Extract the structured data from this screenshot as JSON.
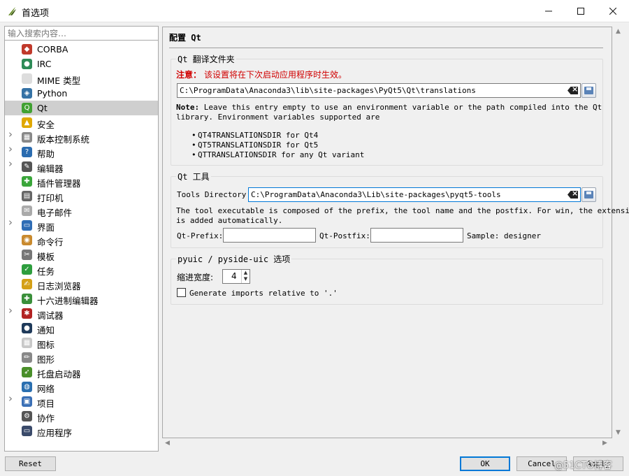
{
  "window": {
    "title": "首选项"
  },
  "sidebar": {
    "search_placeholder": "输入搜索内容…",
    "items": [
      {
        "label": "CORBA",
        "icon": "corba-icon",
        "color": "#c0392b",
        "glyph": "◆",
        "expandable": false
      },
      {
        "label": "IRC",
        "icon": "irc-icon",
        "color": "#2e8b57",
        "glyph": "●",
        "expandable": false
      },
      {
        "label": "MIME 类型",
        "icon": "mime-icon",
        "color": "#dddddd",
        "glyph": "",
        "expandable": false
      },
      {
        "label": "Python",
        "icon": "python-icon",
        "color": "#3572a5",
        "glyph": "◈",
        "expandable": false
      },
      {
        "label": "Qt",
        "icon": "qt-icon",
        "color": "#41a132",
        "glyph": "Q",
        "expandable": false,
        "selected": true
      },
      {
        "label": "安全",
        "icon": "lock-icon",
        "color": "#e0a800",
        "glyph": "▲",
        "expandable": false
      },
      {
        "label": "版本控制系统",
        "icon": "vcs-icon",
        "color": "#888888",
        "glyph": "▦",
        "expandable": true
      },
      {
        "label": "帮助",
        "icon": "help-icon",
        "color": "#2b6cb0",
        "glyph": "?",
        "expandable": true
      },
      {
        "label": "编辑器",
        "icon": "editor-icon",
        "color": "#555555",
        "glyph": "✎",
        "expandable": true
      },
      {
        "label": "插件管理器",
        "icon": "plugin-icon",
        "color": "#3aa63a",
        "glyph": "✚",
        "expandable": false
      },
      {
        "label": "打印机",
        "icon": "printer-icon",
        "color": "#666666",
        "glyph": "▤",
        "expandable": false
      },
      {
        "label": "电子邮件",
        "icon": "email-icon",
        "color": "#aaaaaa",
        "glyph": "✉",
        "expandable": false
      },
      {
        "label": "界面",
        "icon": "interface-icon",
        "color": "#2f6db5",
        "glyph": "▭",
        "expandable": true
      },
      {
        "label": "命令行",
        "icon": "shell-icon",
        "color": "#c98a2e",
        "glyph": "◉",
        "expandable": false
      },
      {
        "label": "模板",
        "icon": "scissors-icon",
        "color": "#777777",
        "glyph": "✂",
        "expandable": false
      },
      {
        "label": "任务",
        "icon": "task-icon",
        "color": "#2e9e3e",
        "glyph": "✓",
        "expandable": false
      },
      {
        "label": "日志浏览器",
        "icon": "log-icon",
        "color": "#d4a017",
        "glyph": "✍",
        "expandable": false
      },
      {
        "label": "十六进制编辑器",
        "icon": "hex-icon",
        "color": "#3a8f3a",
        "glyph": "✚",
        "expandable": false
      },
      {
        "label": "调试器",
        "icon": "bug-icon",
        "color": "#b22222",
        "glyph": "✱",
        "expandable": true
      },
      {
        "label": "通知",
        "icon": "notification-icon",
        "color": "#1f3a5a",
        "glyph": "●",
        "expandable": false
      },
      {
        "label": "图标",
        "icon": "icons-icon",
        "color": "#c8c8c8",
        "glyph": "▦",
        "expandable": false
      },
      {
        "label": "图形",
        "icon": "graphics-icon",
        "color": "#888888",
        "glyph": "✏",
        "expandable": false
      },
      {
        "label": "托盘启动器",
        "icon": "tray-icon",
        "color": "#4a8f2a",
        "glyph": "➶",
        "expandable": false
      },
      {
        "label": "网络",
        "icon": "network-icon",
        "color": "#2a6fb0",
        "glyph": "◍",
        "expandable": false
      },
      {
        "label": "项目",
        "icon": "project-icon",
        "color": "#3a6fb5",
        "glyph": "▣",
        "expandable": true
      },
      {
        "label": "协作",
        "icon": "cooperation-icon",
        "color": "#555555",
        "glyph": "⚙",
        "expandable": false
      },
      {
        "label": "应用程序",
        "icon": "application-icon",
        "color": "#3a4a6a",
        "glyph": "▭",
        "expandable": false
      }
    ]
  },
  "page": {
    "title": "配置 Qt",
    "translations": {
      "group_title": "Qt 翻译文件夹",
      "warning_label": "注意：",
      "warning_text": "该设置将在下次启动应用程序时生效。",
      "path": "C:\\ProgramData\\Anaconda3\\lib\\site-packages\\PyQt5\\Qt\\translations",
      "note_label": "Note:",
      "note_line1": "Leave this entry empty to use an environment variable or the path compiled into the Qt",
      "note_line2": "library. Environment variables supported are",
      "env_vars": [
        "QT4TRANSLATIONSDIR for Qt4",
        "QT5TRANSLATIONSDIR for Qt5",
        "QTTRANSLATIONSDIR for any Qt variant"
      ]
    },
    "tools": {
      "group_title": "Qt 工具",
      "dir_label": "Tools Directory:",
      "dir_value": "C:\\ProgramData\\Anaconda3\\Lib\\site-packages\\pyqt5-tools",
      "desc_line1": "The tool executable is composed of the prefix, the tool name and the postfix. For win, the extension",
      "desc_line2": "is added automatically.",
      "prefix_label": "Qt-Prefix:",
      "prefix_value": "",
      "postfix_label": "Qt-Postfix:",
      "postfix_value": "",
      "sample": "Sample: designer"
    },
    "pyuic": {
      "group_title": "pyuic / pyside-uic 选项",
      "indent_label": "缩进宽度:",
      "indent_value": "4",
      "relative_imports_label": "Generate imports relative to '.'",
      "relative_imports_checked": false
    }
  },
  "buttons": {
    "reset": "Reset",
    "ok": "OK",
    "cancel": "Cancel",
    "apply": "Apply"
  },
  "watermark": "@51CTO博客"
}
